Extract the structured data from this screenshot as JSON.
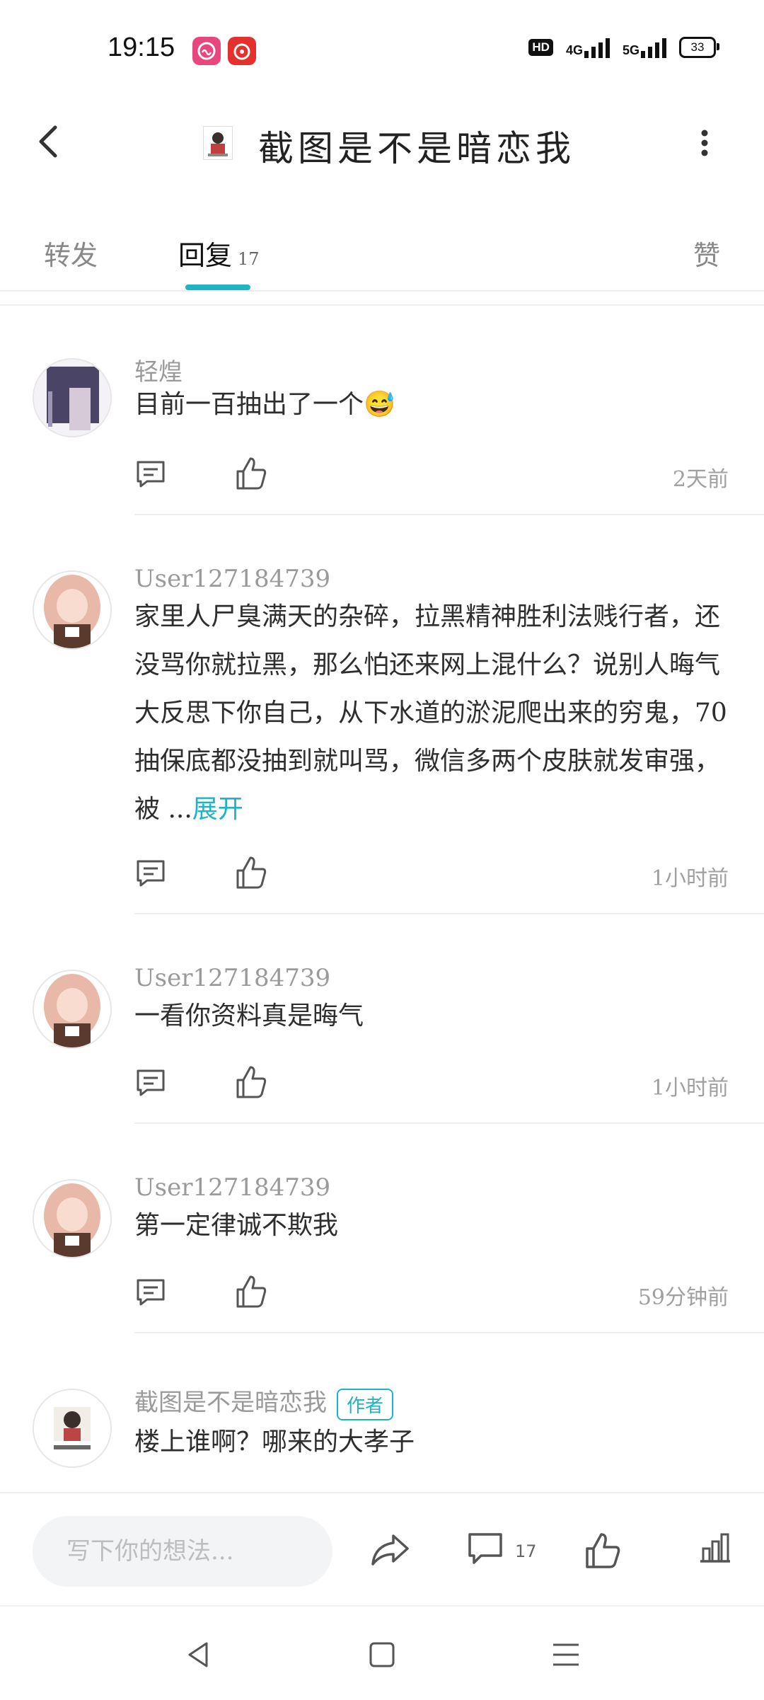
{
  "status_bar": {
    "time": "19:15",
    "hd_label": "HD",
    "net1": "4G",
    "net2": "5G",
    "battery": "33",
    "app_icons": [
      "music-app-icon",
      "netease-cloud-music-icon"
    ]
  },
  "header": {
    "title": "截图是不是暗恋我",
    "back_icon": "chevron-left-icon",
    "more_icon": "more-vertical-icon"
  },
  "tabs": {
    "repost": "转发",
    "replies": "回复",
    "replies_count": "17",
    "likes": "赞"
  },
  "comments": [
    {
      "user": "轻煌",
      "text": "目前一百抽出了一个😅",
      "time": "2天前"
    },
    {
      "user": "User127184739",
      "text": "家里人尸臭满天的杂碎，拉黑精神胜利法贱行者，还没骂你就拉黑，那么怕还来网上混什么？说别人晦气大反思下你自己，从下水道的淤泥爬出来的穷鬼，70抽保底都没抽到就叫骂，微信多两个皮肤就发审强，被 ...",
      "expand": "展开",
      "time": "1小时前"
    },
    {
      "user": "User127184739",
      "text": "一看你资料真是晦气",
      "time": "1小时前"
    },
    {
      "user": "User127184739",
      "text": "第一定律诚不欺我",
      "time": "59分钟前"
    },
    {
      "user": "截图是不是暗恋我",
      "badge": "作者",
      "text": "楼上谁啊？哪来的大孝子",
      "time": ""
    }
  ],
  "bottom_bar": {
    "input_placeholder": "写下你的想法...",
    "comments_count": "17"
  },
  "colors": {
    "accent": "#1fb3c5",
    "text": "#2e2e2e",
    "muted": "#9a9a9a"
  }
}
